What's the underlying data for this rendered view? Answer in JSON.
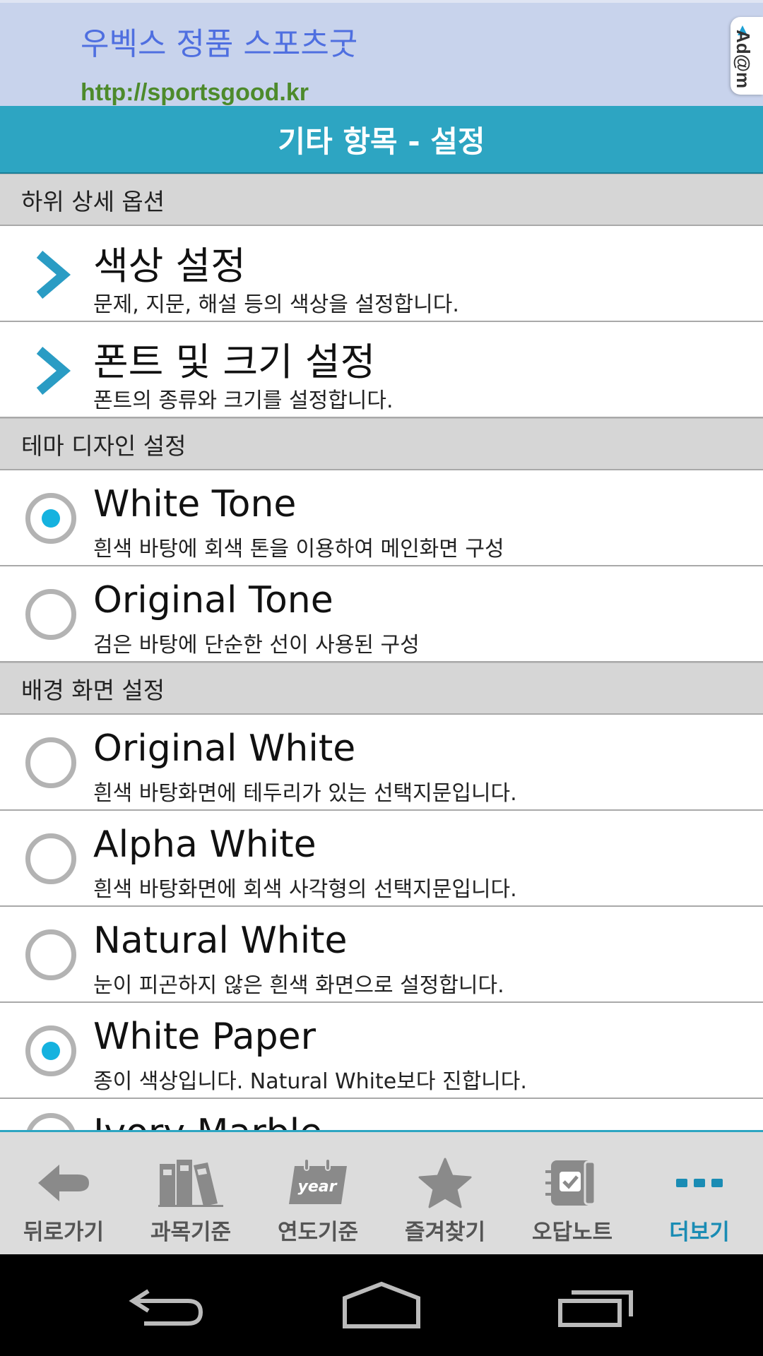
{
  "ad": {
    "title": "우벡스 정품 스포츠굿",
    "url": "http://sportsgood.kr",
    "badge": "Ad@m"
  },
  "header": {
    "title": "기타 항목 - 설정"
  },
  "sections": [
    {
      "label": "하위 상세 옵션",
      "items": [
        {
          "type": "nav",
          "title": "색상 설정",
          "desc": "문제, 지문, 해설 등의 색상을 설정합니다."
        },
        {
          "type": "nav",
          "title": "폰트 및 크기 설정",
          "desc": "폰트의 종류와 크기를 설정합니다."
        }
      ]
    },
    {
      "label": "테마 디자인 설정",
      "items": [
        {
          "type": "radio",
          "selected": true,
          "title": "White Tone",
          "desc": "흰색 바탕에 회색 톤을 이용하여 메인화면 구성"
        },
        {
          "type": "radio",
          "selected": false,
          "title": "Original Tone",
          "desc": "검은 바탕에 단순한 선이 사용된 구성"
        }
      ]
    },
    {
      "label": "배경 화면 설정",
      "items": [
        {
          "type": "radio",
          "selected": false,
          "title": "Original White",
          "desc": "흰색 바탕화면에 테두리가 있는 선택지문입니다."
        },
        {
          "type": "radio",
          "selected": false,
          "title": "Alpha White",
          "desc": "흰색 바탕화면에 회색 사각형의 선택지문입니다."
        },
        {
          "type": "radio",
          "selected": false,
          "title": "Natural White",
          "desc": "눈이 피곤하지 않은 흰색 화면으로 설정합니다."
        },
        {
          "type": "radio",
          "selected": true,
          "title": "White Paper",
          "desc": "종이 색상입니다. Natural White보다 진합니다."
        },
        {
          "type": "radio",
          "selected": false,
          "title": "Ivory Marble",
          "desc": ""
        }
      ]
    }
  ],
  "tabs": [
    {
      "label": "뒤로가기",
      "icon": "back-arrow-icon",
      "active": false
    },
    {
      "label": "과목기준",
      "icon": "books-icon",
      "active": false
    },
    {
      "label": "연도기준",
      "icon": "year-calendar-icon",
      "active": false
    },
    {
      "label": "즐겨찾기",
      "icon": "star-icon",
      "active": false
    },
    {
      "label": "오답노트",
      "icon": "notebook-check-icon",
      "active": false
    },
    {
      "label": "더보기",
      "icon": "more-dots-icon",
      "active": true
    }
  ],
  "tab_year_text": "year",
  "colors": {
    "header": "#2da5c2",
    "radio_selected": "#15b2df",
    "chevron": "#2a9cc4",
    "active_tab": "#1a8cb4"
  }
}
